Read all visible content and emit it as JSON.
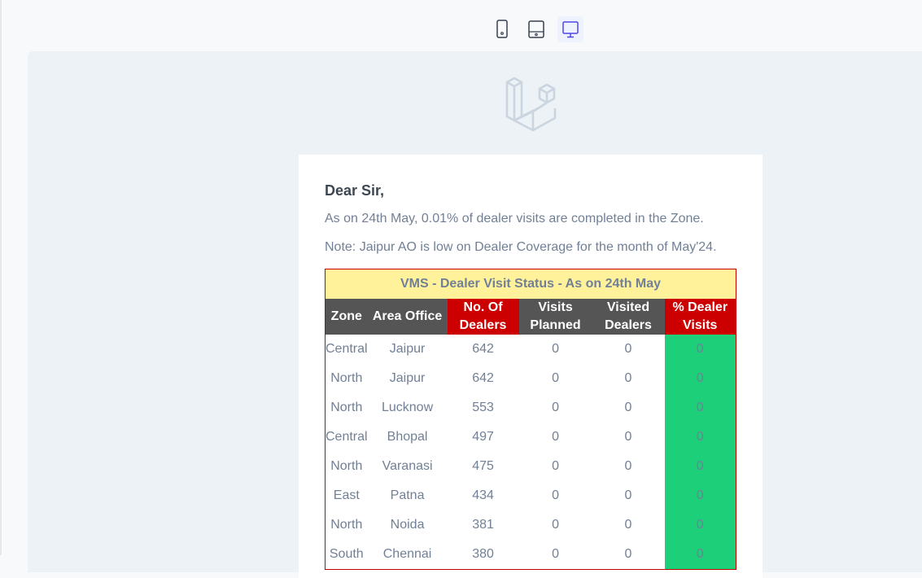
{
  "colors": {
    "title_bg": "#fff29a",
    "header_dark": "#555555",
    "header_red": "#cc0000",
    "pct_green": "#1ecf7a",
    "canvas_bg": "#edf2f7",
    "active_device_bg": "#eef2ff"
  },
  "device_bar": {
    "icons": [
      "mobile-icon",
      "tablet-icon",
      "desktop-icon"
    ],
    "active": "desktop"
  },
  "logo": "laravel-logo",
  "email": {
    "greeting": "Dear Sir,",
    "line1": "As on 24th May, 0.01% of dealer visits are completed in the Zone.",
    "line2": "Note: Jaipur AO is low on Dealer Coverage for the month of May'24.",
    "table": {
      "title": "VMS - Dealer Visit Status - As on 24th May",
      "columns": {
        "zone": "Zone",
        "area_office": "Area Office",
        "dealers": [
          "No. Of",
          "Dealers"
        ],
        "planned": [
          "Visits",
          "Planned"
        ],
        "visited": [
          "Visited",
          "Dealers"
        ],
        "pct": [
          "% Dealer",
          "Visits"
        ]
      },
      "rows": [
        {
          "zone": "Central",
          "area_office": "Jaipur",
          "dealers": "642",
          "planned": "0",
          "visited": "0",
          "pct": "0"
        },
        {
          "zone": "North",
          "area_office": "Jaipur",
          "dealers": "642",
          "planned": "0",
          "visited": "0",
          "pct": "0"
        },
        {
          "zone": "North",
          "area_office": "Lucknow",
          "dealers": "553",
          "planned": "0",
          "visited": "0",
          "pct": "0"
        },
        {
          "zone": "Central",
          "area_office": "Bhopal",
          "dealers": "497",
          "planned": "0",
          "visited": "0",
          "pct": "0"
        },
        {
          "zone": "North",
          "area_office": "Varanasi",
          "dealers": "475",
          "planned": "0",
          "visited": "0",
          "pct": "0"
        },
        {
          "zone": "East",
          "area_office": "Patna",
          "dealers": "434",
          "planned": "0",
          "visited": "0",
          "pct": "0"
        },
        {
          "zone": "North",
          "area_office": "Noida",
          "dealers": "381",
          "planned": "0",
          "visited": "0",
          "pct": "0"
        },
        {
          "zone": "South",
          "area_office": "Chennai",
          "dealers": "380",
          "planned": "0",
          "visited": "0",
          "pct": "0"
        }
      ]
    }
  }
}
